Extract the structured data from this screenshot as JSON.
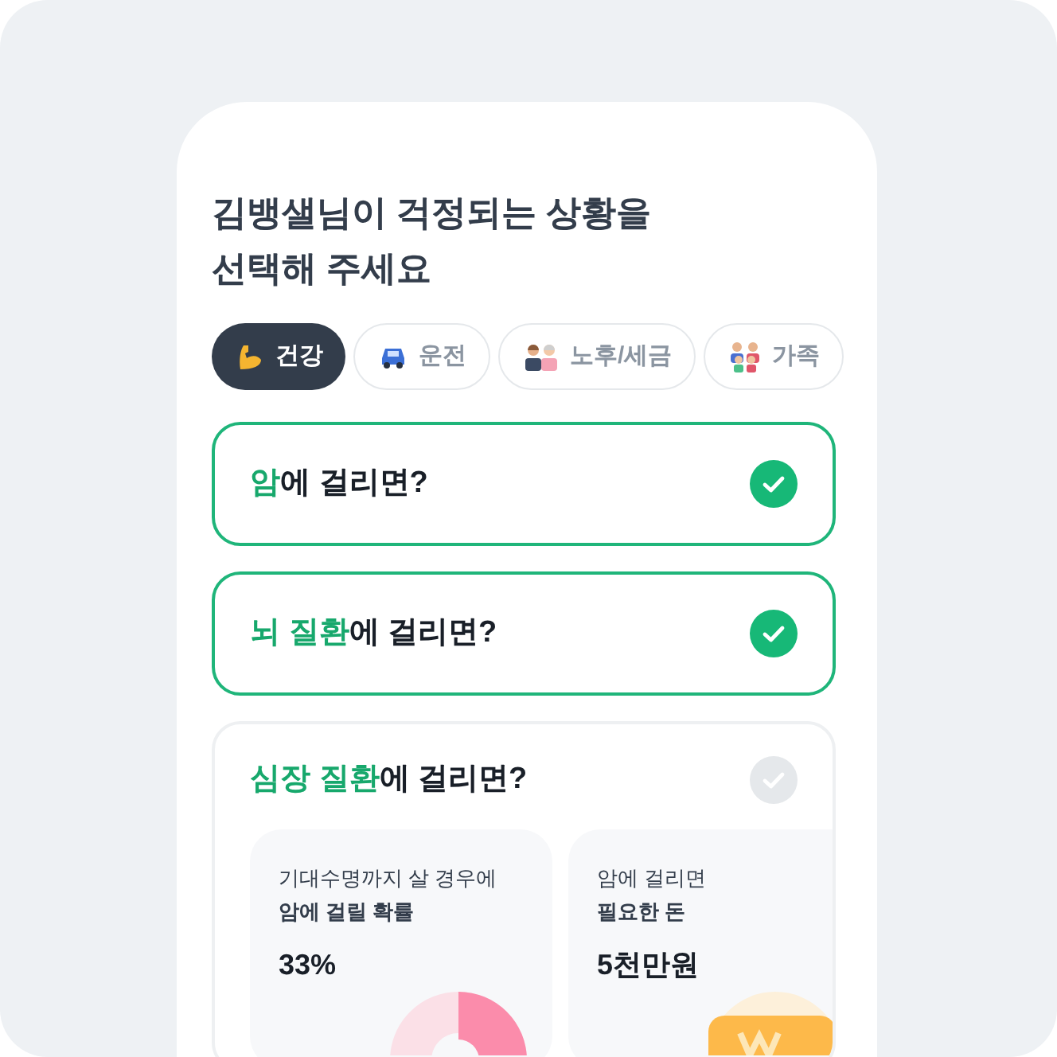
{
  "title_lines": [
    "김뱅샐님이 걱정되는 상황을",
    "선택해 주세요"
  ],
  "tabs": [
    {
      "label": "건강",
      "kind": "arm",
      "selected": true
    },
    {
      "label": "운전",
      "kind": "car",
      "selected": false
    },
    {
      "label": "노후/세금",
      "kind": "couple",
      "selected": false
    },
    {
      "label": "가족",
      "kind": "family",
      "selected": false
    }
  ],
  "situations": [
    {
      "highlight": "암",
      "rest": "에 걸리면?",
      "checked": true
    },
    {
      "highlight": "뇌 질환",
      "rest": "에 걸리면?",
      "checked": true
    },
    {
      "highlight": "심장 질환",
      "rest": "에 걸리면?",
      "checked": false,
      "stats": [
        {
          "line1": "기대수명까지 살 경우에",
          "line2": "암에 걸릴 확률",
          "value": "33%",
          "kind": "donut"
        },
        {
          "line1": "암에 걸리면",
          "line2": "필요한 돈",
          "value": "5천만원",
          "kind": "coin"
        }
      ]
    }
  ]
}
